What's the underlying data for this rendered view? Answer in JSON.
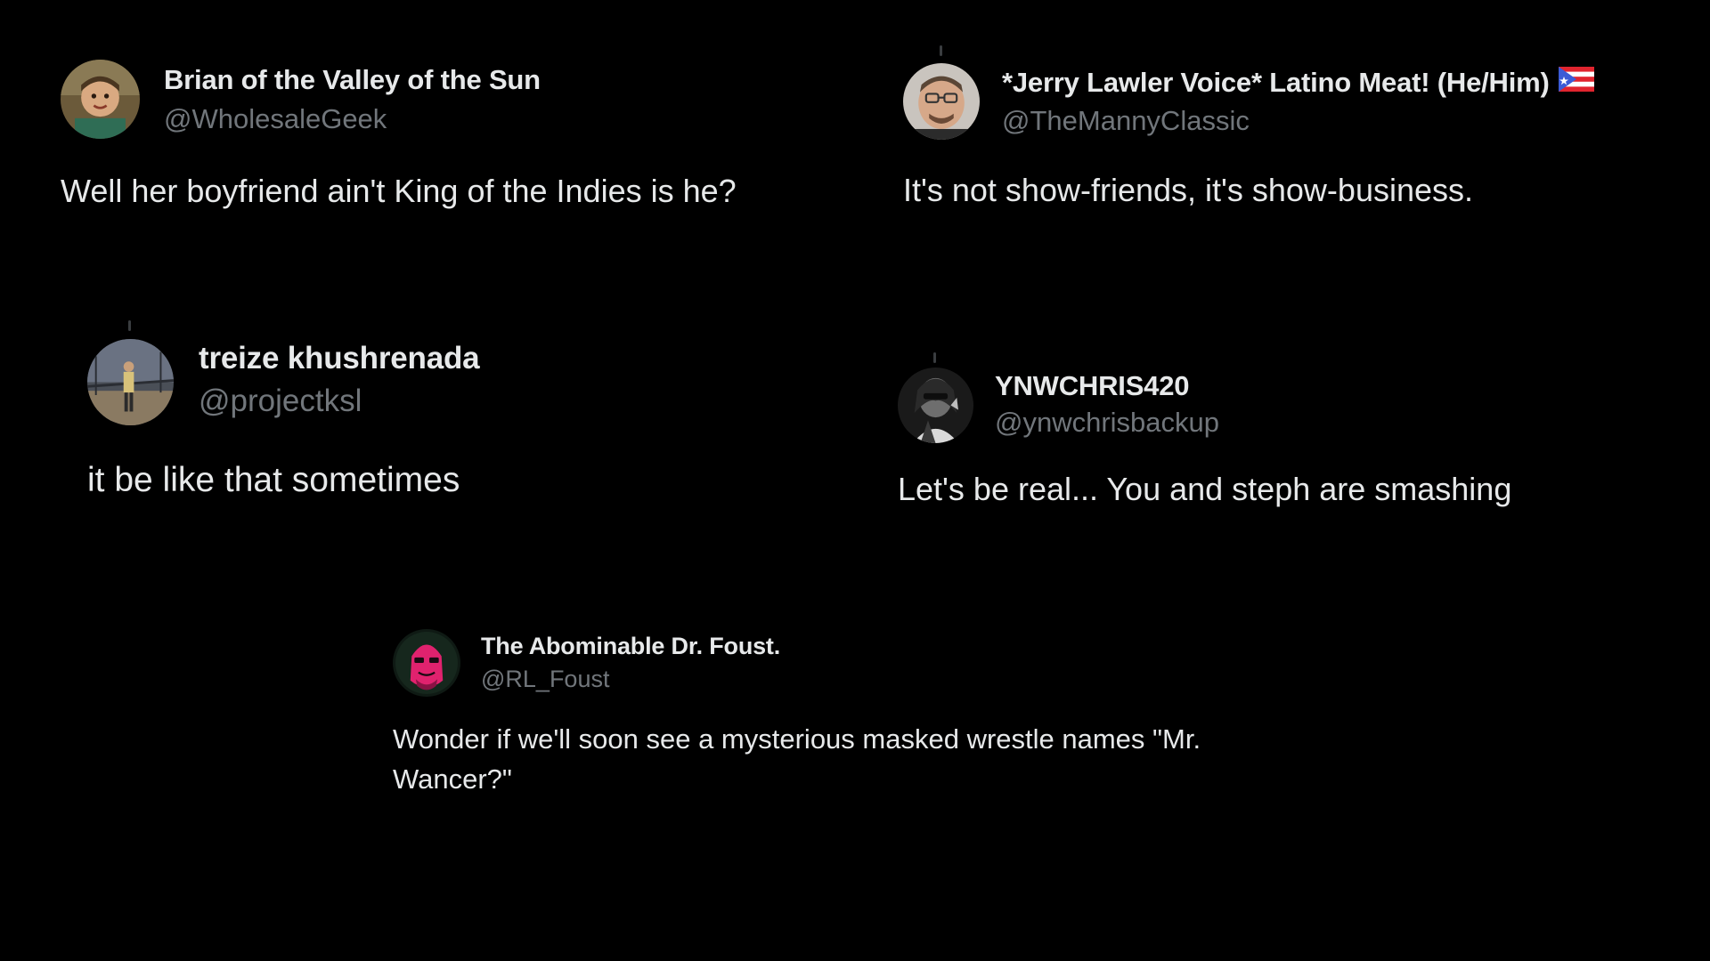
{
  "tweets": [
    {
      "name": "Brian of the Valley of the Sun",
      "handle": "@WholesaleGeek",
      "text": "Well her boyfriend ain't King of the Indies is he?",
      "avatar": "child-photo-avatar"
    },
    {
      "name": "*Jerry Lawler Voice* Latino Meat! (He/Him)",
      "handle": "@TheMannyClassic",
      "text": "It's not show-friends, it's show-business.",
      "avatar": "man-with-glasses-avatar",
      "flag": "puerto-rico-flag-icon"
    },
    {
      "name": "treize khushrenada",
      "handle": "@projectksl",
      "text": "it be like that sometimes",
      "avatar": "person-on-bridge-avatar"
    },
    {
      "name": "YNWCHRIS420",
      "handle": "@ynwchrisbackup",
      "text": "Let's be real... You and steph are smashing",
      "avatar": "bw-portrait-avatar"
    },
    {
      "name": "The Abominable Dr. Foust.",
      "handle": "@RL_Foust",
      "text_line1": "Wonder if we'll soon see a mysterious masked wrestle names \"Mr.",
      "text_line2": "Wancer?\"",
      "avatar": "pink-masked-face-avatar"
    }
  ],
  "colors": {
    "background": "#000000",
    "name": "#e7e9ea",
    "handle": "#71767b",
    "text": "#e7e9ea"
  }
}
